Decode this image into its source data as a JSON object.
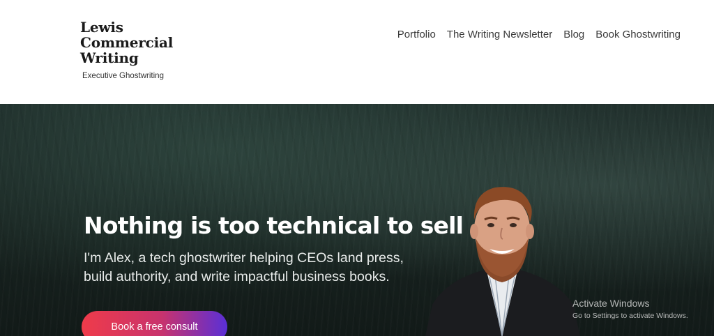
{
  "brand": {
    "name_lines": [
      "Lewis",
      "Commercial",
      "Writing"
    ],
    "tagline": "Executive Ghostwriting"
  },
  "nav": {
    "items": [
      {
        "label": "Portfolio"
      },
      {
        "label": "The Writing Newsletter"
      },
      {
        "label": "Blog"
      },
      {
        "label": "Book Ghostwriting"
      }
    ]
  },
  "hero": {
    "heading": "Nothing is too technical to sell",
    "subtext": "I'm Alex, a tech ghostwriter helping CEOs land press, build authority, and write impactful business books.",
    "cta_label": "Book a free consult"
  },
  "watermark": {
    "title": "Activate Windows",
    "subtitle": "Go to Settings to activate Windows."
  },
  "colors": {
    "hero_background": "#1c2a27",
    "cta_gradient_start": "#ef3b4a",
    "cta_gradient_end": "#5a2fd6",
    "nav_text": "#3a3a3a"
  }
}
